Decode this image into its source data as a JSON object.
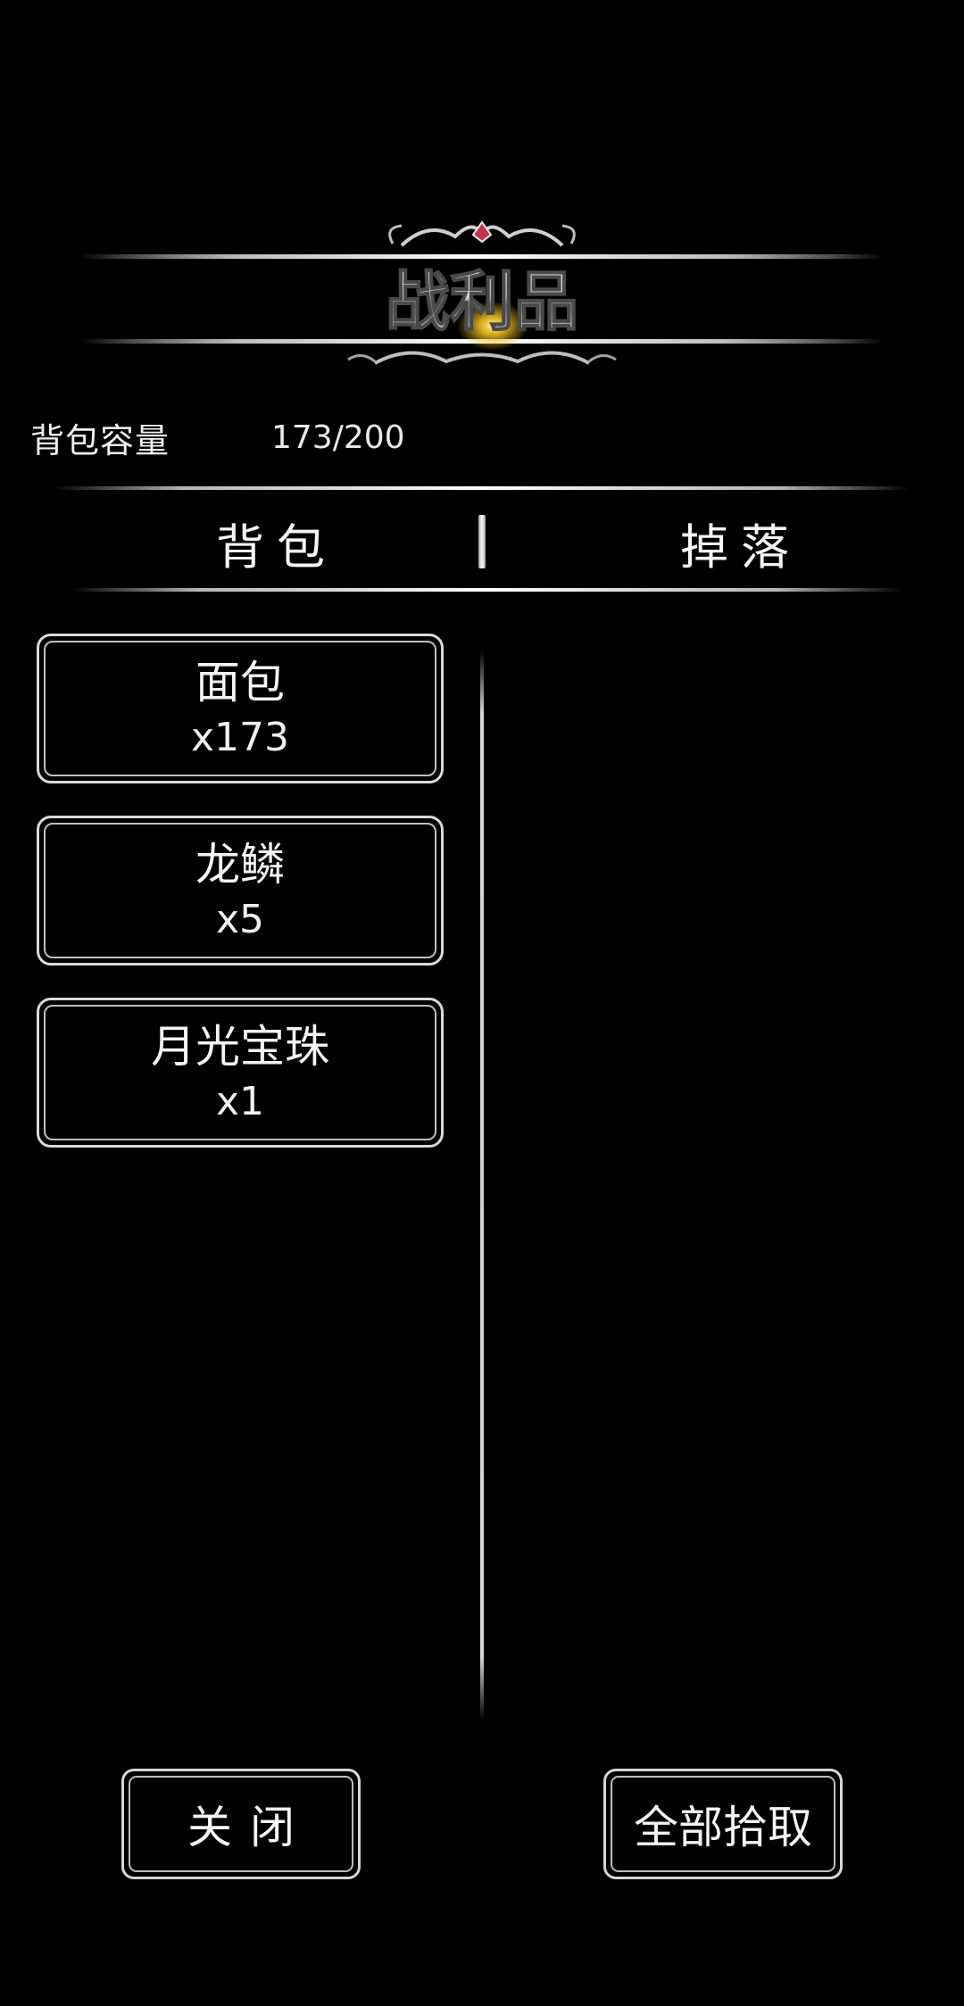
{
  "header": {
    "title": "战利品"
  },
  "capacity": {
    "label": "背包容量",
    "value": "173/200"
  },
  "tabs": [
    {
      "label": "背包"
    },
    {
      "label": "掉落"
    }
  ],
  "items": [
    {
      "name": "面包",
      "count": "x173"
    },
    {
      "name": "龙鳞",
      "count": "x5"
    },
    {
      "name": "月光宝珠",
      "count": "x1"
    }
  ],
  "buttons": {
    "close": "关闭",
    "pick_all": "全部拾取"
  },
  "colors": {
    "background": "#000000",
    "text": "#f2f2f2",
    "border": "#d9d9d9",
    "title_glow": "#f0c020"
  }
}
